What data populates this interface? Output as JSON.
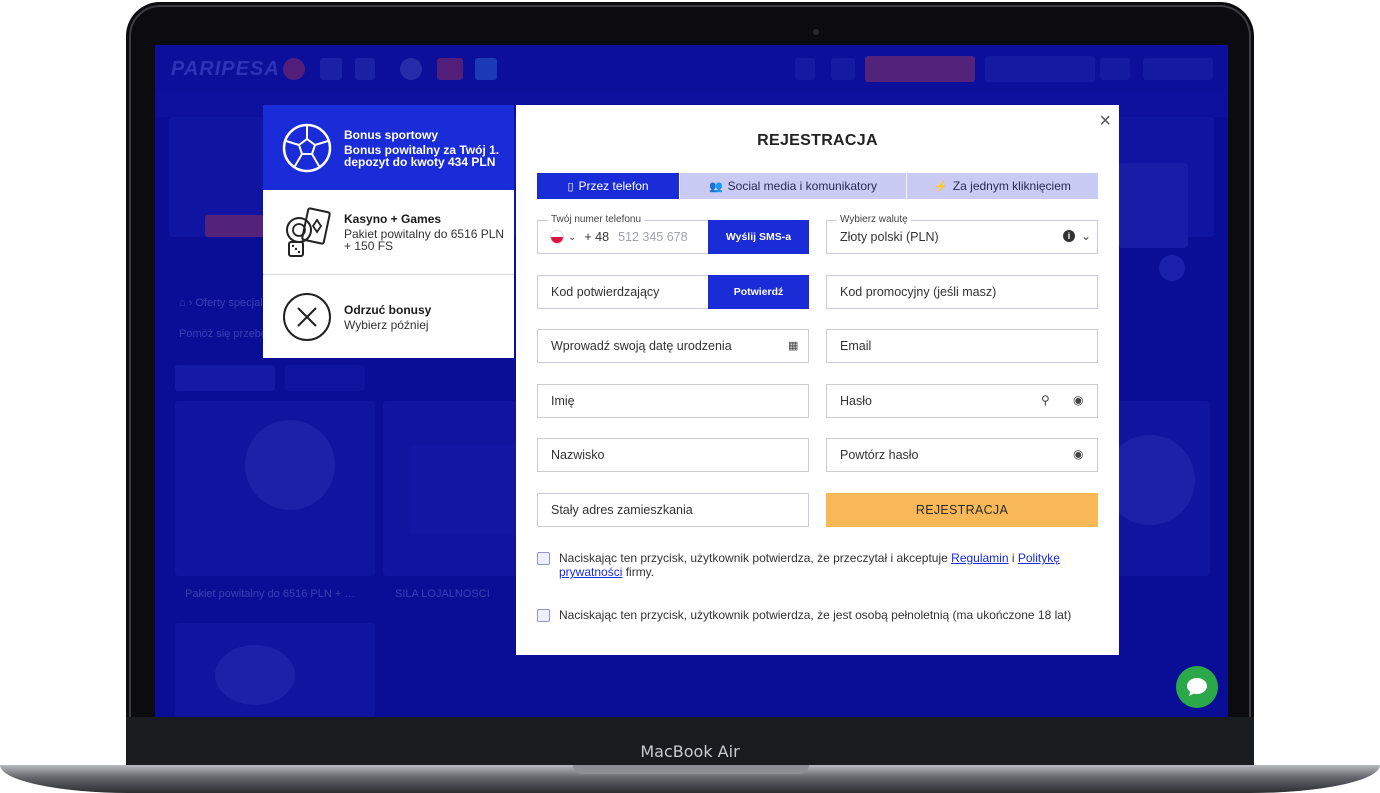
{
  "device": {
    "label": "MacBook Air"
  },
  "site": {
    "logo": "PARIPESA"
  },
  "bonuses": [
    {
      "title": "Bonus sportowy",
      "description": "Bonus powitalny za Twój 1. depozyt do kwoty 434 PLN",
      "icon": "soccer-ball-icon",
      "active": true
    },
    {
      "title": "Kasyno + Games",
      "description": "Pakiet powitalny do 6516 PLN + 150 FS",
      "icon": "casino-chips-cards-icon",
      "active": false
    },
    {
      "title": "Odrzuć bonusy",
      "description": "Wybierz później",
      "icon": "close-circle-icon",
      "active": false
    }
  ],
  "modal": {
    "title": "REJESTRACJA",
    "close": "×",
    "tabs": [
      {
        "label": "Przez telefon",
        "icon": "phone-icon",
        "active": true
      },
      {
        "label": "Social media i komunikatory",
        "icon": "users-icon",
        "active": false
      },
      {
        "label": "Za jednym kliknięciem",
        "icon": "lightning-icon",
        "active": false
      }
    ],
    "phone": {
      "label": "Twój numer telefonu",
      "country_code": "+ 48",
      "placeholder": "512 345 678",
      "send_sms_label": "Wyślij SMS-a"
    },
    "currency": {
      "label": "Wybierz walutę",
      "value": "Złoty polski (PLN)"
    },
    "confirmation_code": {
      "placeholder": "Kod potwierdzający",
      "confirm_label": "Potwierdź"
    },
    "promo_code": {
      "placeholder": "Kod promocyjny (jeśli masz)"
    },
    "birth_date": {
      "placeholder": "Wprowadź swoją datę urodzenia"
    },
    "email": {
      "placeholder": "Email"
    },
    "first_name": {
      "placeholder": "Imię"
    },
    "password": {
      "placeholder": "Hasło"
    },
    "last_name": {
      "placeholder": "Nazwisko"
    },
    "repeat_password": {
      "placeholder": "Powtórz hasło"
    },
    "address": {
      "placeholder": "Stały adres zamieszkania"
    },
    "register_label": "REJESTRACJA",
    "consent_terms": {
      "prefix": "Naciskając ten przycisk, użytkownik potwierdza, że przeczytał i akceptuje ",
      "terms_link": "Regulamin",
      "joiner": " i ",
      "privacy_link": "Politykę prywatności",
      "suffix": " firmy."
    },
    "consent_age": "Naciskając ten przycisk, użytkownik potwierdza, że jest osobą pełnoletnią (ma ukończone 18 lat)"
  },
  "colors": {
    "brand_blue": "#1a2cd8",
    "register_orange": "#f8b857",
    "chat_green": "#2aa84a"
  }
}
